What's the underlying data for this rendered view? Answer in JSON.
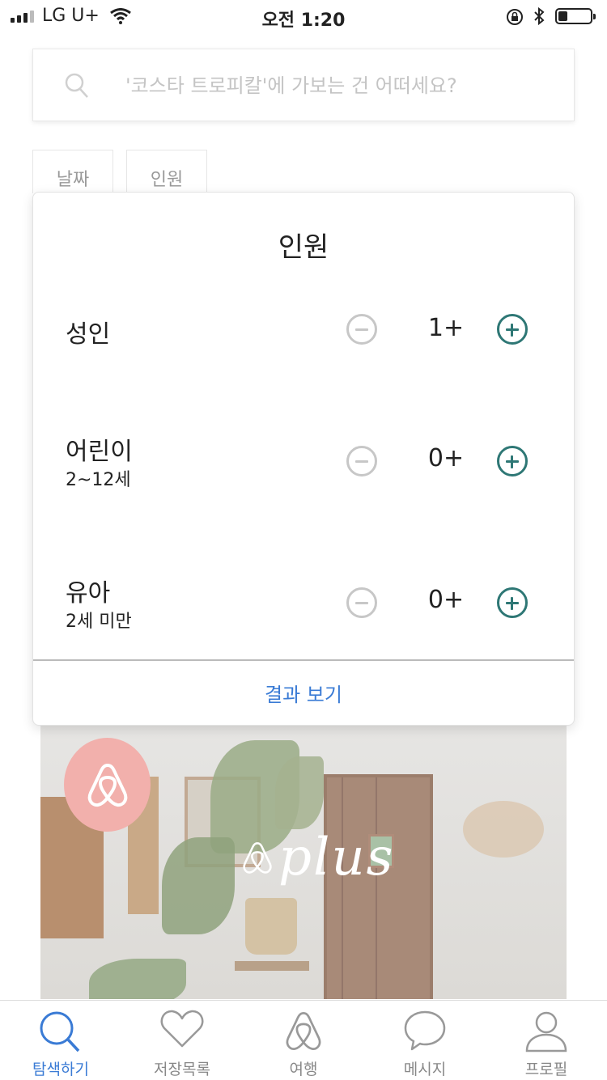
{
  "status_bar": {
    "carrier": "LG U+",
    "time": "오전 1:20",
    "battery_level": 0.3
  },
  "search": {
    "placeholder": "'코스타 트로피칼'에 가보는 건 어떠세요?"
  },
  "filters": {
    "date_label": "날짜",
    "guests_label": "인원"
  },
  "guest_popup": {
    "title": "인원",
    "rows": [
      {
        "label": "성인",
        "sublabel": "",
        "count": "1+"
      },
      {
        "label": "어린이",
        "sublabel": "2~12세",
        "count": "0+"
      },
      {
        "label": "유아",
        "sublabel": "2세 미만",
        "count": "0+"
      }
    ],
    "show_results_label": "결과 보기"
  },
  "promo": {
    "brand_text": "plus"
  },
  "tabbar": {
    "items": [
      {
        "label": "탐색하기",
        "icon": "search-icon",
        "active": true
      },
      {
        "label": "저장목록",
        "icon": "heart-icon",
        "active": false
      },
      {
        "label": "여행",
        "icon": "airbnb-logo-icon",
        "active": false
      },
      {
        "label": "메시지",
        "icon": "message-bubble-icon",
        "active": false
      },
      {
        "label": "프로필",
        "icon": "profile-icon",
        "active": false
      }
    ]
  },
  "colors": {
    "accent_blue": "#3a7bd5",
    "plus_teal": "#2e7775",
    "minus_gray": "#c7c7c7",
    "logo_pink": "#f2b0ac"
  }
}
